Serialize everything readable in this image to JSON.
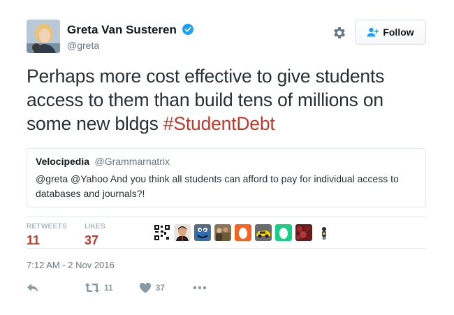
{
  "author": {
    "display_name": "Greta Van Susteren",
    "handle": "@greta",
    "verified": true
  },
  "follow_button": {
    "label": "Follow"
  },
  "tweet": {
    "text": "Perhaps more cost effective to give students access to them than build tens of millions on some new bldgs ",
    "hashtag": "#StudentDebt"
  },
  "quoted_tweet": {
    "display_name": "Velocipedia",
    "handle": "@Grammarnatrix",
    "text": "@greta @Yahoo And you think all students can afford to pay for individual access to databases and journals?!"
  },
  "stats": {
    "retweets_label": "RETWEETS",
    "retweets_count": "11",
    "likes_label": "LIKES",
    "likes_count": "37"
  },
  "likers": [
    {
      "icon": "qr-code-avatar"
    },
    {
      "icon": "person-avatar"
    },
    {
      "icon": "cookie-monster-avatar"
    },
    {
      "icon": "group-photo-avatar"
    },
    {
      "icon": "orange-egg-avatar"
    },
    {
      "icon": "yellow-car-avatar"
    },
    {
      "icon": "green-egg-avatar"
    },
    {
      "icon": "flowers-avatar"
    },
    {
      "icon": "small-figure-avatar"
    }
  ],
  "timestamp": "7:12 AM - 2 Nov 2016",
  "actions": {
    "retweet_count": "11",
    "like_count": "37"
  },
  "colors": {
    "accent": "#c0392b",
    "verified_blue": "#1da1f2",
    "muted": "#8899a6",
    "border": "#e1e8ed"
  }
}
